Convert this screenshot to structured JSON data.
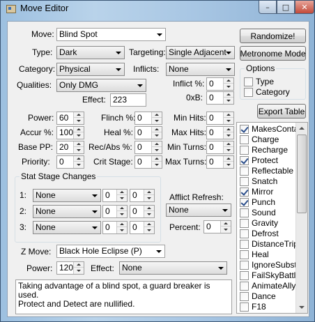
{
  "window": {
    "title": "Move Editor",
    "minimize_glyph": "–",
    "maximize_glyph": "□",
    "close_glyph": "✕",
    "app_icon": "editor-app-icon"
  },
  "move": {
    "label": "Move:",
    "value": "Blind Spot"
  },
  "type": {
    "label": "Type:",
    "value": "Dark"
  },
  "targeting": {
    "label": "Targeting:",
    "value": "Single Adjacent"
  },
  "category": {
    "label": "Category:",
    "value": "Physical"
  },
  "inflicts": {
    "label": "Inflicts:",
    "value": "None"
  },
  "qualities": {
    "label": "Qualities:",
    "value": "Only DMG"
  },
  "inflict_pct": {
    "label": "Inflict %:",
    "value": "0"
  },
  "oxb": {
    "label": "0xB:",
    "value": "0"
  },
  "effect": {
    "label": "Effect:",
    "value": "223"
  },
  "stats": {
    "power": {
      "label": "Power:",
      "value": "60"
    },
    "accuracy": {
      "label": "Accur %:",
      "value": "100"
    },
    "base_pp": {
      "label": "Base PP:",
      "value": "20"
    },
    "priority": {
      "label": "Priority:",
      "value": "0"
    },
    "flinch": {
      "label": "Flinch %:",
      "value": "0"
    },
    "heal": {
      "label": "Heal %:",
      "value": "0"
    },
    "rec_abs": {
      "label": "Rec/Abs %:",
      "value": "0"
    },
    "crit_stage": {
      "label": "Crit Stage:",
      "value": "0"
    },
    "min_hits": {
      "label": "Min Hits:",
      "value": "0"
    },
    "max_hits": {
      "label": "Max Hits:",
      "value": "0"
    },
    "min_turns": {
      "label": "Min Turns:",
      "value": "0"
    },
    "max_turns": {
      "label": "Max Turns:",
      "value": "0"
    }
  },
  "stat_stage": {
    "title": "Stat Stage Changes",
    "rows": [
      {
        "label": "1:",
        "stat": "None",
        "stage": "0",
        "chance": "0"
      },
      {
        "label": "2:",
        "stat": "None",
        "stage": "0",
        "chance": "0"
      },
      {
        "label": "3:",
        "stat": "None",
        "stage": "0",
        "chance": "0"
      }
    ]
  },
  "afflict_refresh": {
    "label": "Afflict Refresh:",
    "value": "None",
    "percent_label": "Percent:",
    "percent_value": "0"
  },
  "z_move": {
    "label": "Z Move:",
    "value": "Black Hole Eclipse (P)",
    "power_label": "Power:",
    "power_value": "120",
    "effect_label": "Effect:",
    "effect_value": "None"
  },
  "description": "Taking advantage of a blind spot, a guard breaker is used.\nProtect and Detect are nullified.",
  "buttons": {
    "randomize": "Randomize!",
    "metronome": "Metronome Mode",
    "export_table": "Export Table"
  },
  "options": {
    "title": "Options",
    "type_label": "Type",
    "type_checked": false,
    "category_label": "Category",
    "category_checked": false
  },
  "flags": [
    {
      "label": "MakesContact",
      "checked": true
    },
    {
      "label": "Charge",
      "checked": false
    },
    {
      "label": "Recharge",
      "checked": false
    },
    {
      "label": "Protect",
      "checked": true
    },
    {
      "label": "Reflectable",
      "checked": false
    },
    {
      "label": "Snatch",
      "checked": false
    },
    {
      "label": "Mirror",
      "checked": true
    },
    {
      "label": "Punch",
      "checked": true
    },
    {
      "label": "Sound",
      "checked": false
    },
    {
      "label": "Gravity",
      "checked": false
    },
    {
      "label": "Defrost",
      "checked": false
    },
    {
      "label": "DistanceTriple",
      "checked": false
    },
    {
      "label": "Heal",
      "checked": false
    },
    {
      "label": "IgnoreSubstitute",
      "checked": false
    },
    {
      "label": "FailSkyBattle",
      "checked": false
    },
    {
      "label": "AnimateAlly",
      "checked": false
    },
    {
      "label": "Dance",
      "checked": false
    },
    {
      "label": "F18",
      "checked": false
    }
  ],
  "colors": {
    "client_bg": "#f0f0f0",
    "check_mark": "#2a4d8a",
    "title_glass": "#b9d3ea"
  }
}
